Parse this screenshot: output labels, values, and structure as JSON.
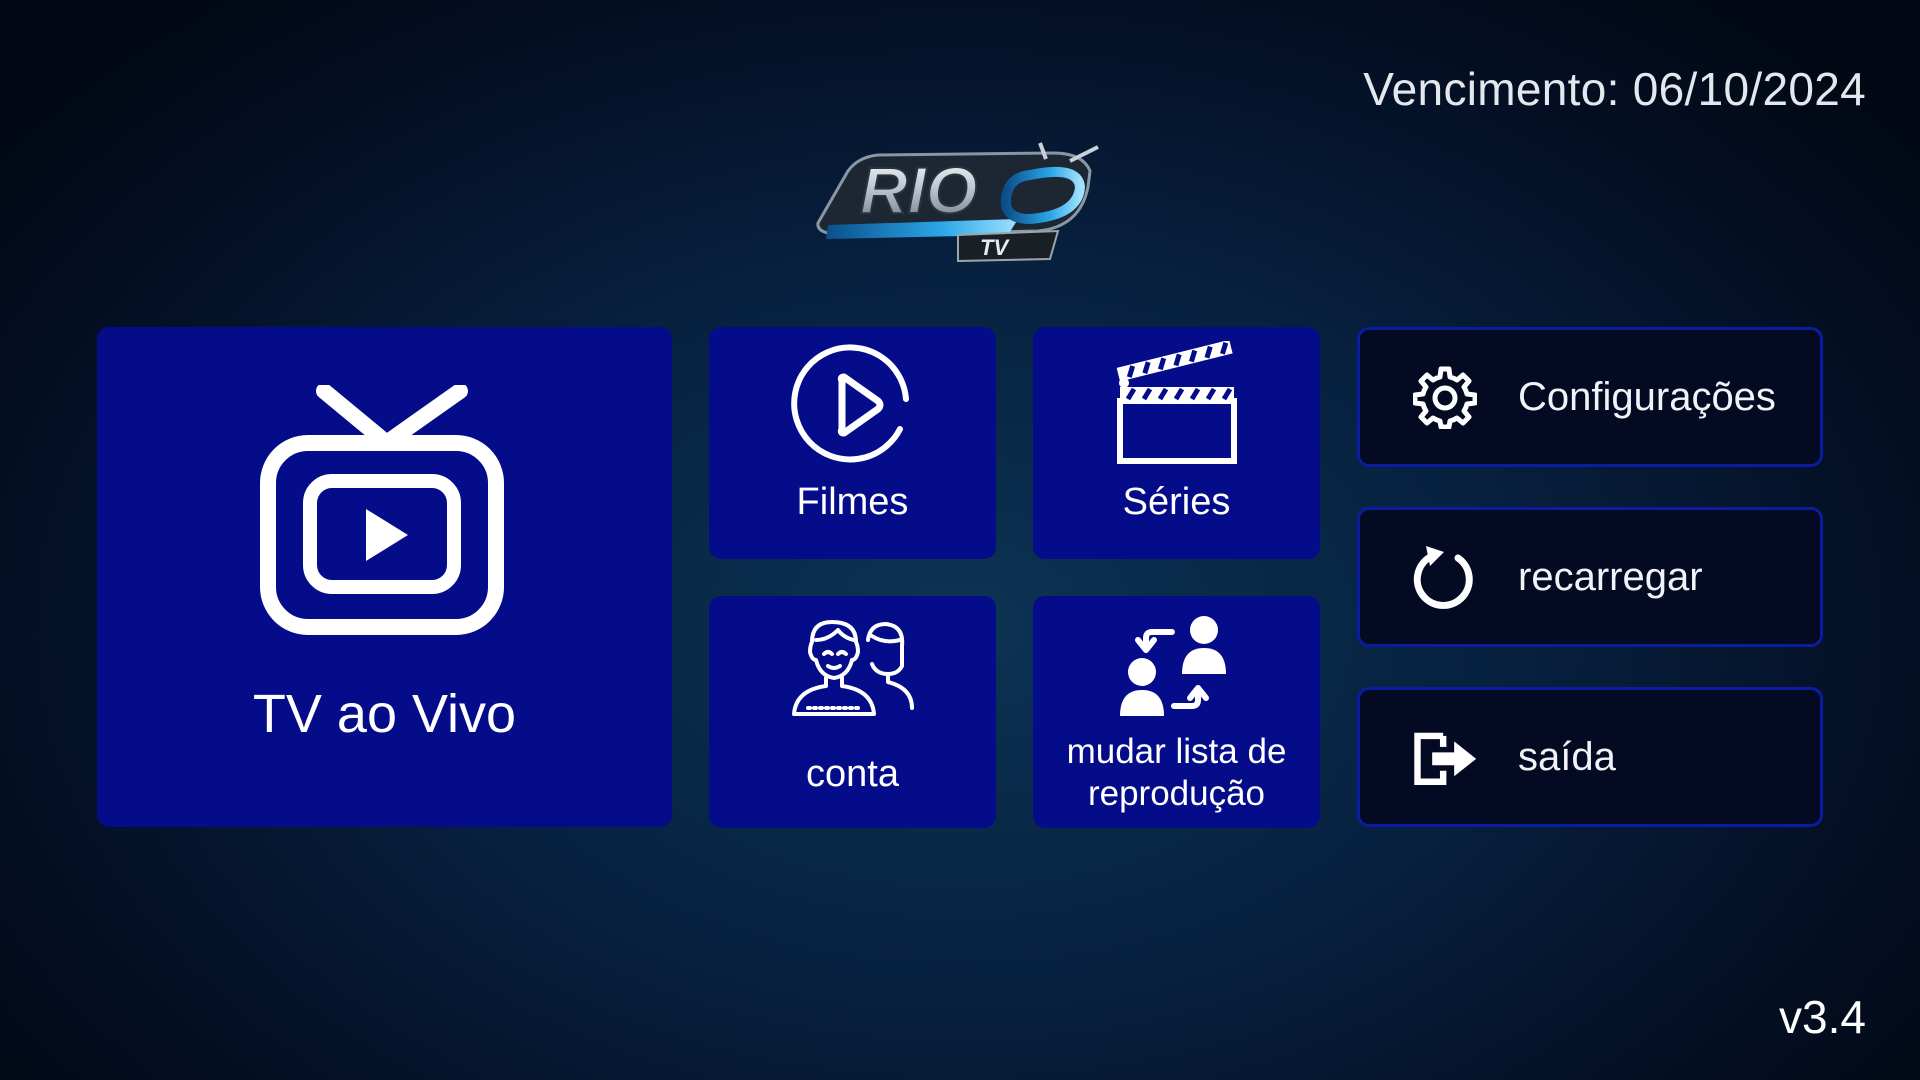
{
  "header": {
    "expiry_text": "Vencimento: 06/10/2024"
  },
  "logo": {
    "main_text": "RIO",
    "sub_text": "TV"
  },
  "tiles": {
    "live_tv": {
      "label": "TV ao Vivo",
      "icon": "tv-play-icon"
    },
    "movies": {
      "label": "Filmes",
      "icon": "play-circle-icon"
    },
    "series": {
      "label": "Séries",
      "icon": "clapperboard-icon"
    },
    "account": {
      "label": "conta",
      "icon": "users-icon"
    },
    "change_playlist": {
      "label_line1": "mudar lista de",
      "label_line2": "reprodução",
      "icon": "swap-users-icon"
    }
  },
  "side_menu": {
    "settings": {
      "label": "Configurações",
      "icon": "gear-icon"
    },
    "reload": {
      "label": "recarregar",
      "icon": "refresh-icon"
    },
    "exit": {
      "label": "saída",
      "icon": "exit-icon"
    }
  },
  "footer": {
    "version": "v3.4"
  },
  "colors": {
    "tile_background": "#040c8a",
    "button_background": "#040a22",
    "button_border": "#0a1ca0",
    "logo_accent": "#2aa7e8"
  }
}
